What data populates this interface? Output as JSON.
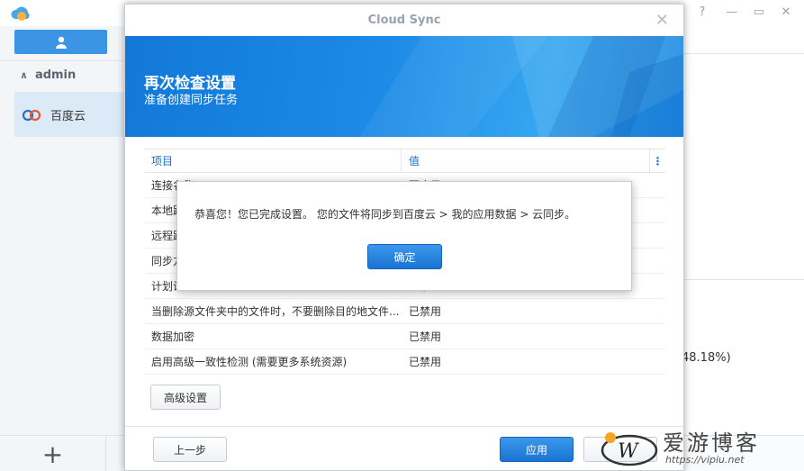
{
  "app": {
    "sidebar": {
      "account_name": "admin",
      "cloud_item_label": "百度云",
      "add_label": "+"
    },
    "background_percent": "48.18%)"
  },
  "dialog": {
    "title": "Cloud Sync",
    "banner_title": "再次检查设置",
    "banner_subtitle": "准备创建同步任务",
    "table": {
      "headers": [
        "项目",
        "值"
      ],
      "rows": [
        {
          "item": "连接名称",
          "value": "百度云"
        },
        {
          "item": "本地路径",
          "value": ""
        },
        {
          "item": "远程路径",
          "value": ""
        },
        {
          "item": "同步方向",
          "value": ""
        },
        {
          "item": "计划设置",
          "value": "已禁用"
        },
        {
          "item": "当删除源文件夹中的文件时，不要删除目的地文件...",
          "value": "已禁用"
        },
        {
          "item": "数据加密",
          "value": "已禁用"
        },
        {
          "item": "启用高级一致性检测 (需要更多系统资源)",
          "value": "已禁用"
        }
      ]
    },
    "advanced_button": "高级设置",
    "prev_button": "上一步",
    "apply_button": "应用",
    "cancel_button": ""
  },
  "alert": {
    "message": "恭喜您！您已完成设置。 您的文件将同步到百度云 > 我的应用数据 > 云同步。",
    "ok_button": "确定"
  },
  "watermark": {
    "title": "爱游博客",
    "url": "https://vipiu.net"
  }
}
